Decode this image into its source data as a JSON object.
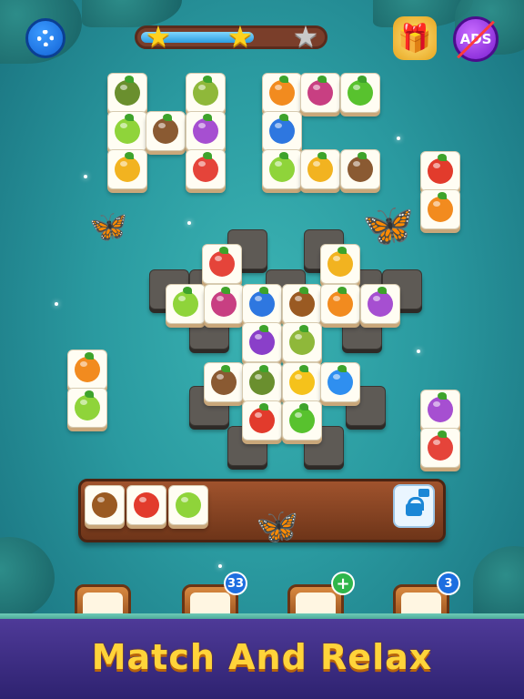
{
  "game": {
    "top_bar": {
      "settings_icon": "gear-icon",
      "level_progress": 0.62,
      "stars_earned": 2,
      "stars_total": 3,
      "gift_icon": "gift-box-icon",
      "ads_label": "ADS"
    },
    "board": {
      "tiles": [
        {
          "fruit": "avocado",
          "color": "#6a8f2e"
        },
        {
          "fruit": "kiwi",
          "color": "#8fb83a"
        },
        {
          "fruit": "lime",
          "color": "#8fd43a"
        },
        {
          "fruit": "coconut",
          "color": "#8a5a32"
        },
        {
          "fruit": "mushroom",
          "color": "#a64fd1"
        },
        {
          "fruit": "pineapple",
          "color": "#f2b320"
        },
        {
          "fruit": "watermelon",
          "color": "#e5443a"
        },
        {
          "fruit": "orange-pumpkin",
          "color": "#f28b1f"
        },
        {
          "fruit": "radish",
          "color": "#c83f82"
        },
        {
          "fruit": "green-apple",
          "color": "#58c22e"
        },
        {
          "fruit": "blue-fig",
          "color": "#2e77e0"
        },
        {
          "fruit": "tomato",
          "color": "#e23b2c"
        },
        {
          "fruit": "grapes",
          "color": "#8a3fc9"
        },
        {
          "fruit": "acorn",
          "color": "#9a5a22"
        },
        {
          "fruit": "blueberry",
          "color": "#2f8ff0"
        },
        {
          "fruit": "yellow-berry",
          "color": "#f5c21b"
        }
      ]
    },
    "tray": {
      "slots": [
        "acorn",
        "tomato",
        "lime"
      ],
      "locked_slot_icon": "lock-video-icon"
    },
    "boosters": [
      {
        "name": "magnet-booster",
        "count": ""
      },
      {
        "name": "shuffle-booster",
        "count": "33"
      },
      {
        "name": "hint-booster",
        "count": "+"
      },
      {
        "name": "undo-booster",
        "count": "3"
      }
    ],
    "tagline": "Match And Relax"
  }
}
